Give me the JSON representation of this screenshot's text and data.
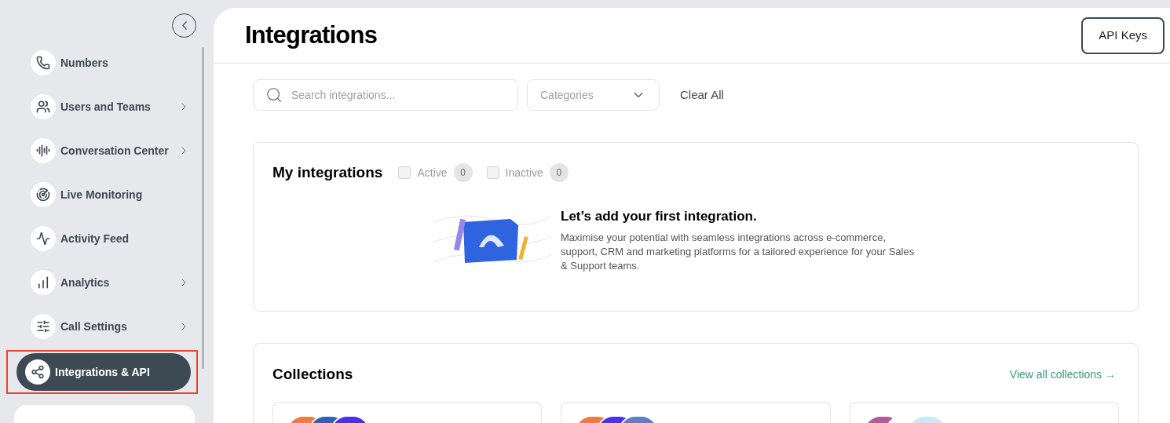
{
  "sidebar": {
    "items": [
      {
        "label": "Numbers",
        "submenu": false,
        "selected": false,
        "highlighted": false
      },
      {
        "label": "Users and Teams",
        "submenu": true,
        "selected": false,
        "highlighted": false
      },
      {
        "label": "Conversation Center",
        "submenu": true,
        "selected": false,
        "highlighted": false
      },
      {
        "label": "Live Monitoring",
        "submenu": false,
        "selected": false,
        "highlighted": false
      },
      {
        "label": "Activity Feed",
        "submenu": false,
        "selected": false,
        "highlighted": false
      },
      {
        "label": "Analytics",
        "submenu": true,
        "selected": false,
        "highlighted": false
      },
      {
        "label": "Call Settings",
        "submenu": true,
        "selected": false,
        "highlighted": false
      },
      {
        "label": "Integrations & API",
        "submenu": false,
        "selected": true,
        "highlighted": true
      }
    ]
  },
  "header": {
    "title": "Integrations",
    "button": "API Keys"
  },
  "filters": {
    "search_placeholder": "Search integrations...",
    "categories_placeholder": "Categories",
    "clear": "Clear All"
  },
  "my_integrations": {
    "title": "My integrations",
    "filters": [
      {
        "label": "Active",
        "count": "0",
        "checked": false
      },
      {
        "label": "Inactive",
        "count": "0",
        "checked": false
      }
    ],
    "empty_title": "Let’s add your first integration.",
    "empty_text": "Maximise your potential with seamless integrations across e-commerce, support, CRM and marketing platforms for a tailored experience for your Sales & Support teams."
  },
  "collections": {
    "title": "Collections",
    "link": "View all collections →",
    "cards": [
      {
        "kind": "logos"
      },
      {
        "kind": "logos"
      },
      {
        "kind": "logos"
      }
    ]
  }
}
